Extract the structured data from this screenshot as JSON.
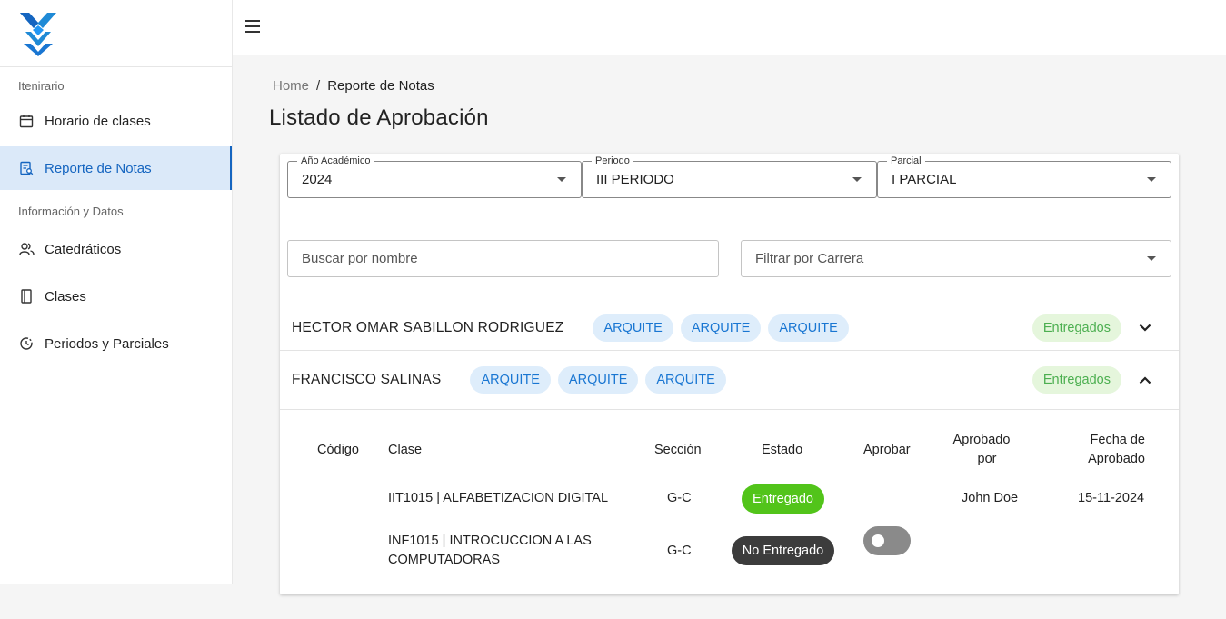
{
  "sidebar": {
    "logo_icon": "brand-x-logo",
    "sections": [
      {
        "label": "Itenirario"
      },
      {
        "label": "Información y Datos"
      }
    ],
    "items": [
      {
        "label": "Horario de clases",
        "icon": "calendar-icon",
        "active": false
      },
      {
        "label": "Reporte de Notas",
        "icon": "report-icon",
        "active": true
      },
      {
        "label": "Catedráticos",
        "icon": "people-icon",
        "active": false
      },
      {
        "label": "Clases",
        "icon": "book-icon",
        "active": false
      },
      {
        "label": "Periodos y Parciales",
        "icon": "history-icon",
        "active": false
      }
    ]
  },
  "topbar": {
    "menu_icon": "hamburger-menu-icon"
  },
  "breadcrumb": {
    "home": "Home",
    "separator": "/",
    "current": "Reporte de Notas"
  },
  "page_title": "Listado de Aprobación",
  "filters": {
    "year": {
      "label": "Año Académico",
      "value": "2024"
    },
    "period": {
      "label": "Periodo",
      "value": "III PERIODO"
    },
    "partial": {
      "label": "Parcial",
      "value": "I PARCIAL"
    },
    "search_placeholder": "Buscar por nombre",
    "career_placeholder": "Filtrar por Carrera"
  },
  "teachers": [
    {
      "name": "HECTOR OMAR SABILLON RODRIGUEZ",
      "chips": [
        "ARQUITE",
        "ARQUITE",
        "ARQUITE"
      ],
      "status": "Entregados",
      "expanded": false
    },
    {
      "name": "FRANCISCO SALINAS",
      "chips": [
        "ARQUITE",
        "ARQUITE",
        "ARQUITE"
      ],
      "status": "Entregados",
      "expanded": true
    }
  ],
  "table": {
    "headers": {
      "code": "Código",
      "class": "Clase",
      "section": "Sección",
      "state": "Estado",
      "approve": "Aprobar",
      "approved_by_1": "Aprobado",
      "approved_by_2": "por",
      "approved_date_1": "Fecha de",
      "approved_date_2": "Aprobado"
    },
    "rows": [
      {
        "code": "",
        "class_1": "IIT1015 | ALFABETIZACION DIGITAL",
        "class_2": "",
        "section": "G-C",
        "state": "Entregado",
        "approved_by": "John Doe",
        "date": "15-11-2024",
        "toggle": false
      },
      {
        "code": "",
        "class_1": "INF1015 | INTROCUCCION A LAS",
        "class_2": "COMPUTADORAS",
        "section": "G-C",
        "state": "No Entregado",
        "approved_by": "",
        "date": "",
        "toggle": false
      }
    ]
  },
  "colors": {
    "primary": "#1976d2",
    "active_bg": "#dbe9f9",
    "success": "#52c41a",
    "success_chip_bg": "#e5f6dc",
    "chip_bg": "#deedfb",
    "dark_pill": "#3c3c3c"
  }
}
